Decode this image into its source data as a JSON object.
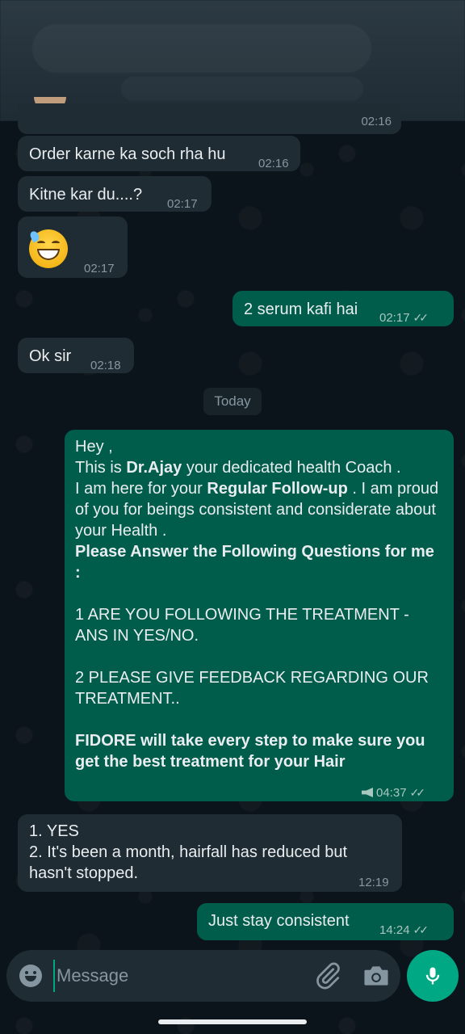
{
  "messages": [
    {
      "text": "Order karne ka soch rha hu",
      "time": "02:16"
    },
    {
      "text": "Kitne kar du....?",
      "time": "02:17"
    },
    {
      "emoji": "grinning-face-with-sweat",
      "time": "02:17"
    },
    {
      "text": "2 serum kafi hai",
      "time": "02:17"
    },
    {
      "text": "Ok sir",
      "time": "02:18"
    }
  ],
  "date_divider": "Today",
  "coach_message": {
    "greeting": "Hey ,",
    "intro_pre": "This is ",
    "intro_name": "Dr.Ajay",
    "intro_post": " your dedicated health Coach .",
    "line2_pre": "I am here for your ",
    "line2_bold": "Regular Follow-up",
    "line2_post": " . I am proud of you for beings consistent and considerate about your Health .",
    "question_heading": "Please Answer the Following Questions for me :",
    "q1": "1 ARE YOU FOLLOWING THE TREATMENT - ANS IN YES/NO.",
    "q2": "2 PLEASE GIVE FEEDBACK REGARDING OUR TREATMENT..",
    "closing": "FIDORE will take every step to make sure you get the best treatment for your Hair",
    "time": "04:37"
  },
  "reply": {
    "line1": "1.  YES",
    "line2": "2.  It's been a month, hairfall has reduced but hasn't stopped.",
    "time": "12:19"
  },
  "last_message": {
    "text": "Just stay consistent",
    "time": "14:24"
  },
  "input": {
    "placeholder": "Message"
  },
  "colors": {
    "incoming": "#202c33",
    "outgoing": "#005c4b",
    "accent": "#00a884",
    "background": "#0b141a"
  }
}
